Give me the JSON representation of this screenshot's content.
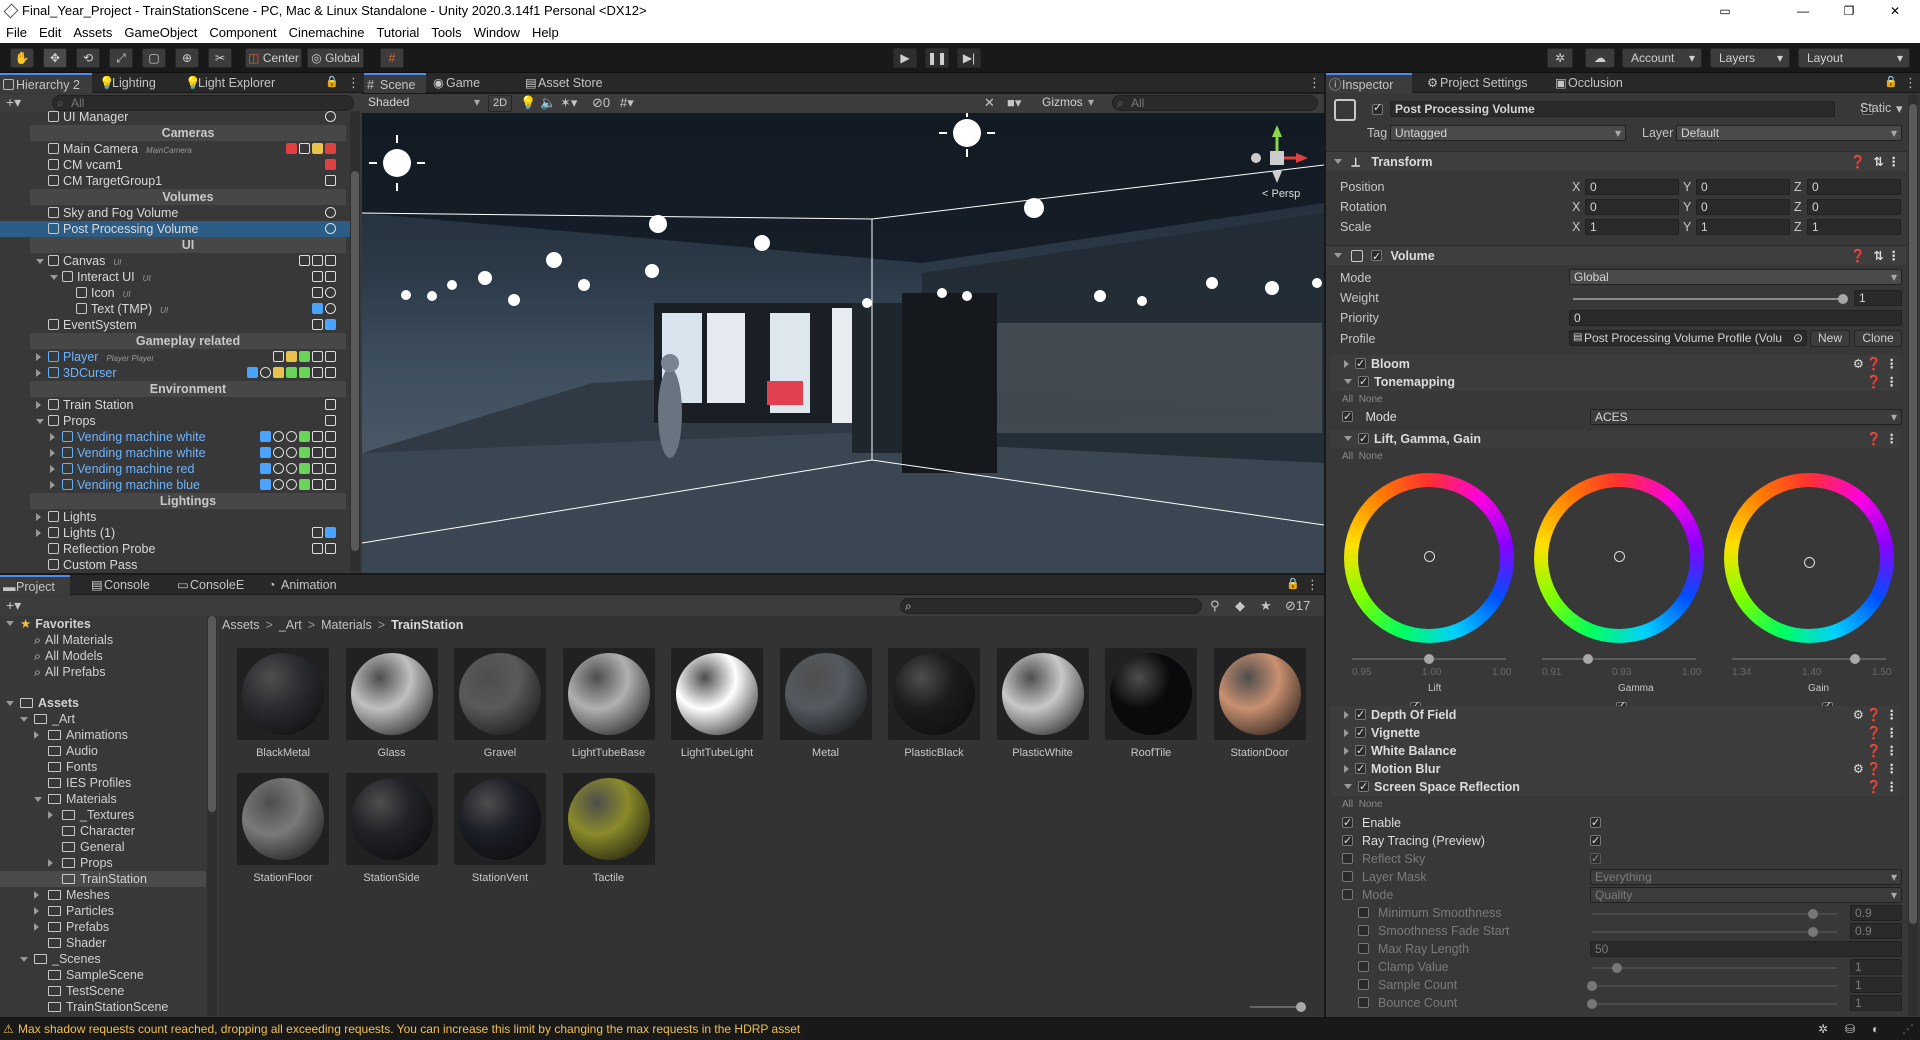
{
  "window": {
    "title": "Final_Year_Project - TrainStationScene - PC, Mac & Linux Standalone - Unity 2020.3.14f1 Personal <DX12>"
  },
  "menu": [
    "File",
    "Edit",
    "Assets",
    "GameObject",
    "Component",
    "Cinemachine",
    "Tutorial",
    "Tools",
    "Window",
    "Help"
  ],
  "toolbar": {
    "center": "Center",
    "global": "Global",
    "account": "Account",
    "layers": "Layers",
    "layout": "Layout"
  },
  "hierarchy": {
    "tab": "Hierarchy 2",
    "tab2": "Lighting",
    "tab3": "Light Explorer",
    "search_placeholder": "All",
    "rows": [
      {
        "label": "UI Manager",
        "kind": "item",
        "indent": 0
      },
      {
        "label": "Cameras",
        "kind": "section"
      },
      {
        "label": "Main Camera",
        "kind": "item",
        "indent": 0,
        "tag": "MainCamera"
      },
      {
        "label": "CM vcam1",
        "kind": "item",
        "indent": 0
      },
      {
        "label": "CM TargetGroup1",
        "kind": "item",
        "indent": 0
      },
      {
        "label": "Volumes",
        "kind": "section"
      },
      {
        "label": "Sky and Fog Volume",
        "kind": "item",
        "indent": 0
      },
      {
        "label": "Post Processing Volume",
        "kind": "item",
        "indent": 0,
        "selected": true
      },
      {
        "label": "UI",
        "kind": "section"
      },
      {
        "label": "Canvas",
        "kind": "item",
        "indent": 0,
        "fold": "open",
        "tag": "UI"
      },
      {
        "label": "Interact UI",
        "kind": "item",
        "indent": 1,
        "fold": "open",
        "tag": "UI"
      },
      {
        "label": "Icon",
        "kind": "item",
        "indent": 2,
        "tag": "UI"
      },
      {
        "label": "Text (TMP)",
        "kind": "item",
        "indent": 2,
        "tag": "UI"
      },
      {
        "label": "EventSystem",
        "kind": "item",
        "indent": 0
      },
      {
        "label": "Gameplay related",
        "kind": "section"
      },
      {
        "label": "Player",
        "kind": "item",
        "indent": 0,
        "fold": "closed",
        "prefab": true,
        "tag": "Player   Player"
      },
      {
        "label": "3DCurser",
        "kind": "item",
        "indent": 0,
        "fold": "closed",
        "prefab": true
      },
      {
        "label": "Environment",
        "kind": "section"
      },
      {
        "label": "Train Station",
        "kind": "item",
        "indent": 0,
        "fold": "closed"
      },
      {
        "label": "Props",
        "kind": "item",
        "indent": 0,
        "fold": "open"
      },
      {
        "label": "Vending machine white",
        "kind": "item",
        "indent": 1,
        "fold": "closed",
        "prefab": true
      },
      {
        "label": "Vending machine white",
        "kind": "item",
        "indent": 1,
        "fold": "closed",
        "prefab": true
      },
      {
        "label": "Vending machine red",
        "kind": "item",
        "indent": 1,
        "fold": "closed",
        "prefab": true
      },
      {
        "label": "Vending machine blue",
        "kind": "item",
        "indent": 1,
        "fold": "closed",
        "prefab": true
      },
      {
        "label": "Lightings",
        "kind": "section"
      },
      {
        "label": "Lights",
        "kind": "item",
        "indent": 0,
        "fold": "closed"
      },
      {
        "label": "Lights (1)",
        "kind": "item",
        "indent": 0,
        "fold": "closed"
      },
      {
        "label": "Reflection Probe",
        "kind": "item",
        "indent": 0
      },
      {
        "label": "Custom Pass",
        "kind": "item",
        "indent": 0
      }
    ]
  },
  "scene": {
    "tab": "Scene",
    "tab2": "Game",
    "tab3": "Asset Store",
    "shading": "Shaded",
    "mode2d": "2D",
    "gizmos": "Gizmos",
    "search_placeholder": "All",
    "persp": "< Persp",
    "hidden_count": "0"
  },
  "project": {
    "tab": "Project",
    "tab2": "Console",
    "tab3": "ConsoleE",
    "tab4": "Animation",
    "hidden_count": "17",
    "favorites": {
      "label": "Favorites",
      "items": [
        "All Materials",
        "All Models",
        "All Prefabs"
      ]
    },
    "tree": [
      {
        "label": "Assets",
        "indent": 0,
        "fold": "open"
      },
      {
        "label": "_Art",
        "indent": 1,
        "fold": "open"
      },
      {
        "label": "Animations",
        "indent": 2,
        "fold": "closed"
      },
      {
        "label": "Audio",
        "indent": 2
      },
      {
        "label": "Fonts",
        "indent": 2
      },
      {
        "label": "IES Profiles",
        "indent": 2
      },
      {
        "label": "Materials",
        "indent": 2,
        "fold": "open"
      },
      {
        "label": "_Textures",
        "indent": 3,
        "fold": "closed"
      },
      {
        "label": "Character",
        "indent": 3
      },
      {
        "label": "General",
        "indent": 3
      },
      {
        "label": "Props",
        "indent": 3,
        "fold": "closed"
      },
      {
        "label": "TrainStation",
        "indent": 3,
        "selected": true
      },
      {
        "label": "Meshes",
        "indent": 2,
        "fold": "closed"
      },
      {
        "label": "Particles",
        "indent": 2,
        "fold": "closed"
      },
      {
        "label": "Prefabs",
        "indent": 2,
        "fold": "closed"
      },
      {
        "label": "Shader",
        "indent": 2
      },
      {
        "label": "_Scenes",
        "indent": 1,
        "fold": "open"
      },
      {
        "label": "SampleScene",
        "indent": 2
      },
      {
        "label": "TestScene",
        "indent": 2
      },
      {
        "label": "TrainStationScene",
        "indent": 2
      }
    ],
    "breadcrumb": [
      "Assets",
      "_Art",
      "Materials",
      "TrainStation"
    ],
    "materials": [
      {
        "name": "BlackMetal",
        "color": "#2a2c30"
      },
      {
        "name": "Glass",
        "color": "#c0c0c0"
      },
      {
        "name": "Gravel",
        "color": "#5a5a5a"
      },
      {
        "name": "LightTubeBase",
        "color": "#b0b0b0"
      },
      {
        "name": "LightTubeLight",
        "color": "#ffffff"
      },
      {
        "name": "Metal",
        "color": "#555a60"
      },
      {
        "name": "PlasticBlack",
        "color": "#1c1c1c"
      },
      {
        "name": "PlasticWhite",
        "color": "#c8c8c8"
      },
      {
        "name": "RoofTile",
        "color": "#0a0a0c"
      },
      {
        "name": "StationDoor",
        "color": "#c89070"
      },
      {
        "name": "StationFloor",
        "color": "#7a7a78"
      },
      {
        "name": "StationSide",
        "color": "#202226"
      },
      {
        "name": "StationVent",
        "color": "#1c1e26"
      },
      {
        "name": "Tactile",
        "color": "#8a8a2a"
      }
    ]
  },
  "inspector": {
    "tab": "Inspector",
    "tab2": "Project Settings",
    "tab3": "Occlusion",
    "object_name": "Post Processing Volume",
    "static_label": "Static",
    "tag_label": "Tag",
    "tag_value": "Untagged",
    "layer_label": "Layer",
    "layer_value": "Default",
    "transform": {
      "title": "Transform",
      "rows": [
        {
          "label": "Position",
          "x": "0",
          "y": "0",
          "z": "0"
        },
        {
          "label": "Rotation",
          "x": "0",
          "y": "0",
          "z": "0"
        },
        {
          "label": "Scale",
          "x": "1",
          "y": "1",
          "z": "1"
        }
      ]
    },
    "volume": {
      "title": "Volume",
      "mode_label": "Mode",
      "mode_value": "Global",
      "weight_label": "Weight",
      "weight_value": "1",
      "weight_fraction": 1.0,
      "priority_label": "Priority",
      "priority_value": "0",
      "profile_label": "Profile",
      "profile_value": "Post Processing Volume Profile (Volu",
      "new_btn": "New",
      "clone_btn": "Clone"
    },
    "overrides": {
      "bloom": "Bloom",
      "tonemapping": "Tonemapping",
      "all": "All",
      "none": "None",
      "tm_mode_label": "Mode",
      "tm_mode_value": "ACES",
      "lgg": "Lift, Gamma, Gain",
      "wheels": [
        {
          "label": "Lift",
          "ticks": [
            "0.95",
            "1.00",
            "1.00"
          ],
          "slider": 0.5
        },
        {
          "label": "Gamma",
          "ticks": [
            "0.91",
            "0.93",
            "1.00"
          ],
          "slider": 0.3
        },
        {
          "label": "Gain",
          "ticks": [
            "1.34",
            "1.40",
            "1.50"
          ],
          "slider": 0.8
        }
      ],
      "dof": "Depth Of Field",
      "vignette": "Vignette",
      "white_balance": "White Balance",
      "motion_blur": "Motion Blur",
      "ssr": "Screen Space Reflection",
      "ssr_rows": [
        {
          "label": "Enable",
          "value": "",
          "checked": true,
          "overridden": true,
          "type": "check"
        },
        {
          "label": "Ray Tracing (Preview)",
          "value": "",
          "checked": true,
          "overridden": true,
          "type": "check"
        },
        {
          "label": "Reflect Sky",
          "value": "",
          "checked": true,
          "overridden": false,
          "type": "check"
        },
        {
          "label": "Layer Mask",
          "value": "Everything",
          "overridden": false,
          "type": "drop"
        },
        {
          "label": "Mode",
          "value": "Quality",
          "overridden": false,
          "type": "drop"
        },
        {
          "label": "Minimum Smoothness",
          "value": "0.9",
          "overridden": false,
          "type": "slider",
          "fraction": 0.9,
          "sub": true
        },
        {
          "label": "Smoothness Fade Start",
          "value": "0.9",
          "overridden": false,
          "type": "slider",
          "fraction": 0.9,
          "sub": true
        },
        {
          "label": "Max Ray Length",
          "value": "50",
          "overridden": false,
          "type": "field",
          "sub": true
        },
        {
          "label": "Clamp Value",
          "value": "1",
          "overridden": false,
          "type": "slider",
          "fraction": 0.1,
          "sub": true
        },
        {
          "label": "Sample Count",
          "value": "1",
          "overridden": false,
          "type": "slider",
          "fraction": 0.0,
          "sub": true
        },
        {
          "label": "Bounce Count",
          "value": "1",
          "overridden": false,
          "type": "slider",
          "fraction": 0.0,
          "sub": true
        }
      ]
    }
  },
  "status": {
    "message": "Max shadow requests count reached, dropping all exceeding requests. You can increase this limit by changing the max requests in the HDRP asset"
  },
  "colors": {
    "accent": "#4a8cf0",
    "selection": "#2c5d87",
    "warning": "#f0c050",
    "prefab_blue": "#6cb4ff"
  }
}
